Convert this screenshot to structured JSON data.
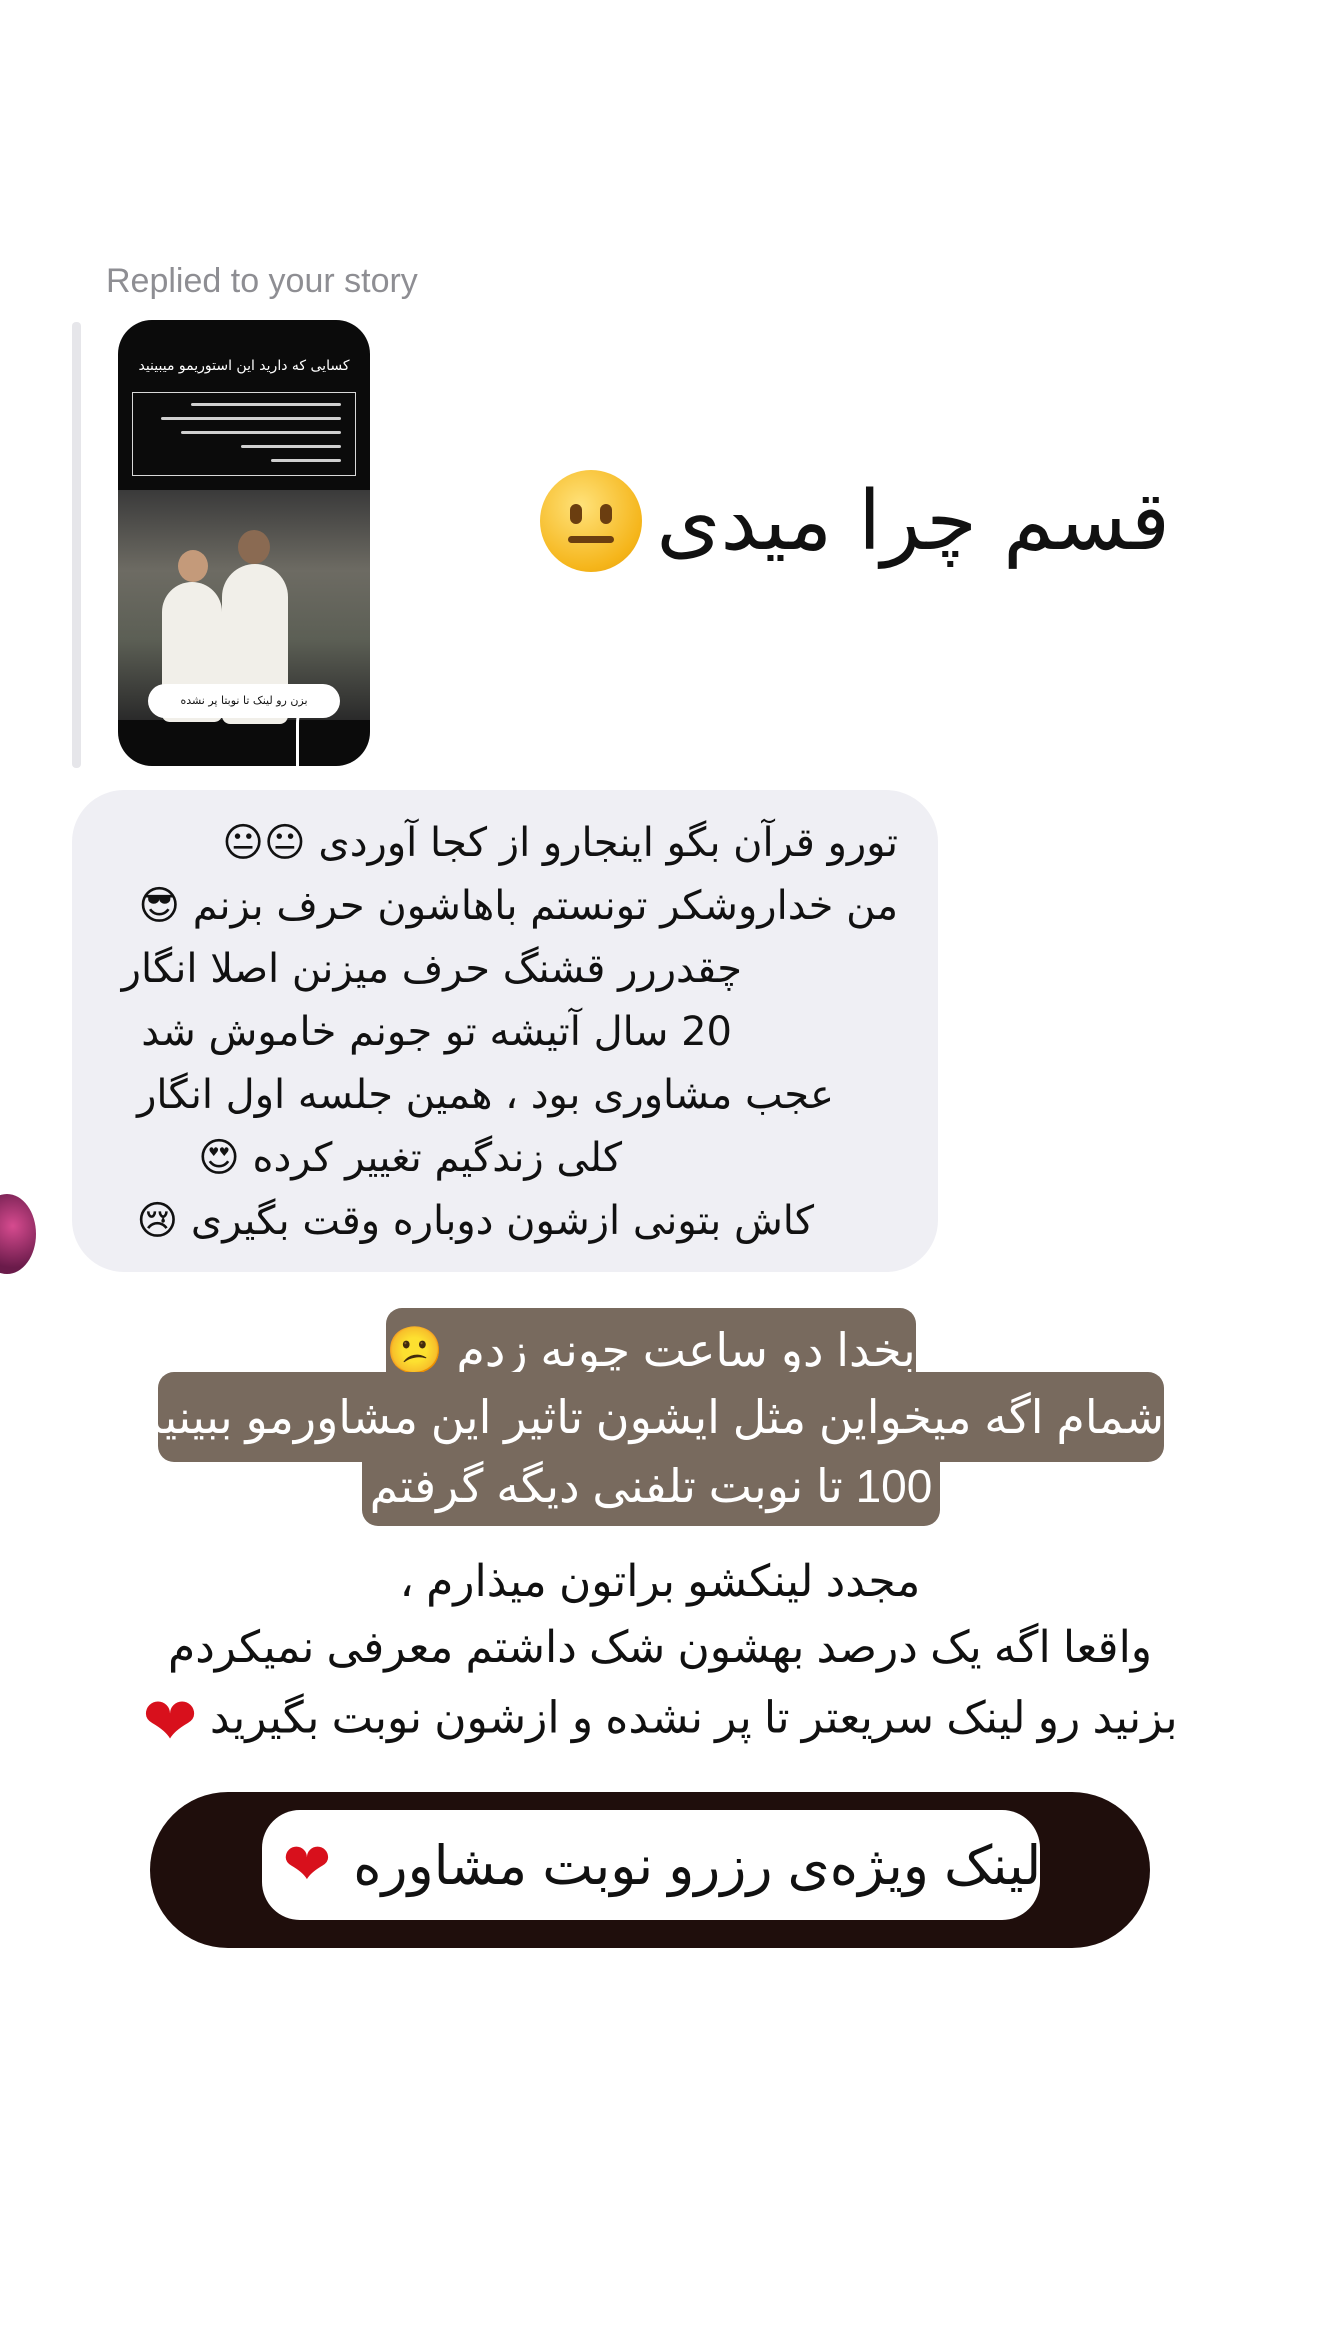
{
  "reply_header": "Replied to your story",
  "story_thumbnail": {
    "title": "کسایی که دارید این استوریمو میبینید",
    "button_label": "بزن رو لینک تا نوبتا پر نشده"
  },
  "reaction": {
    "text": "قسم چرا میدی",
    "emoji": "neutral-face"
  },
  "message": {
    "lines": [
      "تورو قرآن بگو اینجارو از کجا آوردی 😐😐",
      "من خداروشکر تونستم باهاشون حرف بزنم 😎",
      "چقدررر قشنگ حرف میزنن اصلا انگار",
      "20 سال آتیشه تو جونم خاموش شد",
      "عجب مشاوری بود ، همین جلسه اول انگار",
      "کلی زندگیم تغییر کرده 😍",
      "کاش بتونی ازشون دوباره وقت بگیری 😢"
    ]
  },
  "overlay_caption": {
    "line1": "بخدا دو ساعت چونه زدم 😕",
    "line2": "شمام اگه میخواین مثل ایشون تاثیر این مشاورمو ببینید",
    "line3": "100 تا نوبت تلفنی دیگه گرفتم"
  },
  "note": {
    "line1": "مجدد لینکشو براتون میذارم ،",
    "line2": "واقعا اگه یک درصد بهشون شک داشتم معرفی نمیکردم",
    "line3": "بزنید رو لینک سریعتر تا پر نشده و ازشون نوبت بگیرید"
  },
  "link_sticker": {
    "label": "لینک ویژه‌ی رزرو نوبت مشاوره",
    "icon": "link-icon"
  },
  "colors": {
    "bubble_bg": "#efeff4",
    "caption_bg": "#786a5e",
    "sticker_bg": "#1f0e0c",
    "heart": "#d8101c"
  }
}
